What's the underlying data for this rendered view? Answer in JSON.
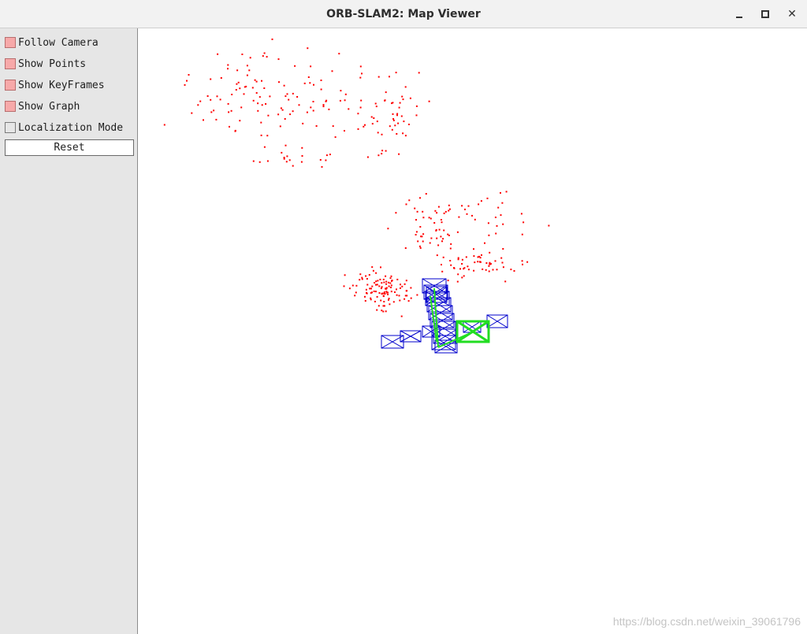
{
  "window": {
    "title": "ORB-SLAM2: Map Viewer",
    "controls": [
      "minimize",
      "maximize",
      "close"
    ]
  },
  "panel": {
    "options": [
      {
        "label": "Follow Camera",
        "checked": true
      },
      {
        "label": "Show Points",
        "checked": true
      },
      {
        "label": "Show KeyFrames",
        "checked": true
      },
      {
        "label": "Show Graph",
        "checked": true
      },
      {
        "label": "Localization Mode",
        "checked": false
      }
    ],
    "reset_label": "Reset"
  },
  "viewer": {
    "map_point_color": "#ff0000",
    "keyframe_color": "#0000cc",
    "current_camera_color": "#22dd22"
  },
  "watermark": "https://blog.csdn.net/weixin_39061796"
}
